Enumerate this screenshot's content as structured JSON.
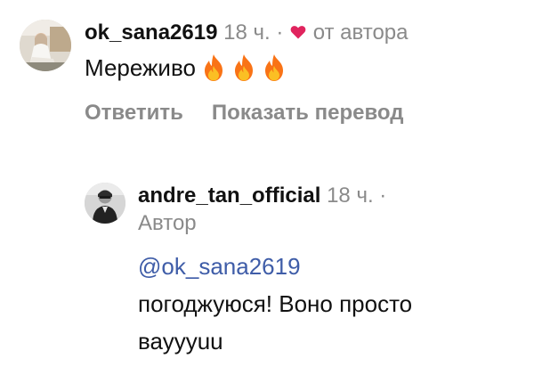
{
  "comments": [
    {
      "username": "ok_sana2619",
      "time": "18 ч.",
      "separator": "·",
      "heart_text": "от автора",
      "text": "Мереживо",
      "reactions": [
        "fire-icon",
        "fire-icon",
        "fire-icon"
      ],
      "actions": [
        "Ответить",
        "Показать перевод"
      ]
    }
  ],
  "reply": {
    "username": "andre_tan_official",
    "time": "18 ч.",
    "separator": "·",
    "badge": "Автор",
    "mention": "@ok_sana2619",
    "text_line1": "погоджуюся! Воно просто",
    "text_line2": "вауууuu"
  },
  "colors": {
    "heart": "#e0245e",
    "muted": "#8a8a8a",
    "mention": "#3f5da8",
    "text": "#111111"
  }
}
